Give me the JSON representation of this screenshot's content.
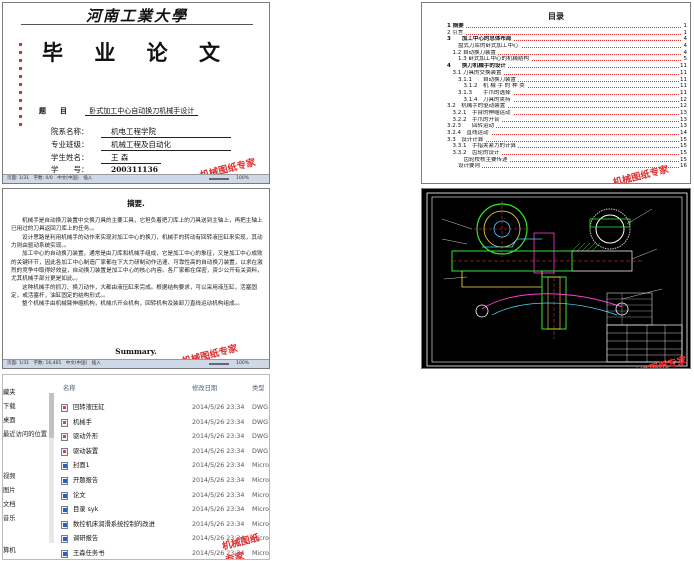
{
  "cover": {
    "school": "河南工業大學",
    "thesis": "毕 业 论 文",
    "title_label": "题　　目",
    "title_value": "卧式加工中心自动换刀机械手设计",
    "college_label": "院系名称：",
    "college_value": "机电工程学院",
    "major_label": "专业班级：",
    "major_value": "机械工程及自动化",
    "student_label": "学生姓名：",
    "student_value": "王  森",
    "id_label": "学　　号：",
    "id_value": "200311136",
    "watermark": "机械图纸专家",
    "status": "页面: 1/31　字数: 0/0　中文(中国)　插入",
    "zoom": "100%"
  },
  "toc": {
    "heading": "目录",
    "items": [
      {
        "text": "1 摘要",
        "page": "1",
        "bold": true
      },
      {
        "text": "2 引言",
        "page": "1",
        "bold": false
      },
      {
        "text": "3　　加工中心的总体布局",
        "page": "4",
        "bold": true
      },
      {
        "text": "　　盘式刀库的卧式加工中心",
        "page": "4",
        "bold": false
      },
      {
        "text": "　1.2 自动换刀装置",
        "page": "4",
        "bold": false
      },
      {
        "text": "　　1.3 卧式加工中心的机械结构",
        "page": "5",
        "bold": false
      },
      {
        "text": "4　　换刀机械手的设计",
        "page": "11",
        "bold": true
      },
      {
        "text": "　3.1 刀具的交换装置",
        "page": "11",
        "bold": false
      },
      {
        "text": "　　3.1.1　　自动换刀装置",
        "page": "11",
        "bold": false
      },
      {
        "text": "　　　3.1.2　机 械 手 的 种 类",
        "page": "11",
        "bold": false
      },
      {
        "text": "　　3.1.3　　手爪的选择",
        "page": "11",
        "bold": false
      },
      {
        "text": "　　　3.1.4　刀具的夹持",
        "page": "12",
        "bold": false
      },
      {
        "text": "3.2　机械手的驱动装置",
        "page": "12",
        "bold": false
      },
      {
        "text": "　3.2.1　手臂的伸缩运动",
        "page": "13",
        "bold": false
      },
      {
        "text": "　3.2.2　手爪的开合",
        "page": "13",
        "bold": false
      },
      {
        "text": "3.2.3　　回转运动",
        "page": "13",
        "bold": false
      },
      {
        "text": "3.2.4　直线运动",
        "page": "14",
        "bold": false
      },
      {
        "text": "3.3　设计计算",
        "page": "15",
        "bold": false
      },
      {
        "text": "　3.3.1　手指夹紧力的计算",
        "page": "15",
        "bold": false
      },
      {
        "text": "　3.3.2　齿轮的设计",
        "page": "15",
        "bold": false
      },
      {
        "text": "　　　齿轮校核主要传递",
        "page": "15",
        "bold": false
      },
      {
        "text": "　　设计要则",
        "page": "16",
        "bold": false
      }
    ]
  },
  "abstract": {
    "heading": "摘要.",
    "paragraphs": [
      "机械手是自动换刀装置中交换刀具的主要工具，它担负着把刀库上的刀具送到主轴上，再把主轴上已用过的刀具返回刀库上的任务。。",
      "设计思路是利用机械手的动作来实现对加工中心的换刀，机械手的转动有回转液压缸来实现，其动力则由驱动系统实现。。",
      "加工中心的自动换刀装置，通常是由刀库和机械手组成，它是加工中心的象征，又是加工中心成败的关键环节，因此各加工中心制造厂家都在下大力研制动作迅速、可靠性高的自动换刀装置，以求在激烈的竞争中取得好效益，自动换刀装置是加工中心的核心内容。各厂家都在保密，资少公开有关资料，尤其机械手部分更是如此。。",
      "这种机械手的抓刀、换刀动作，大都由液压缸来完成。根据结构要求，可以采用液压缸，活塞固定，或活塞杆，油缸固定的结构形式。。",
      "整个机械手由机械臂伸缩机构，机械爪开合机构，回转机构及装卸刀直线运动机构组成。。"
    ],
    "summary_heading": "Summary.",
    "watermark": "机械图纸专家",
    "status": "页面: 1/31　字数: 16,465　中文(中国)　插入",
    "zoom": "100%"
  },
  "cad": {
    "watermark": "机械图纸专家"
  },
  "explorer": {
    "nav": [
      "藏夹",
      "下载",
      "桌面",
      "最近访问的位置",
      "视频",
      "图片",
      "文档",
      "音乐",
      "算机",
      "本地磁盘"
    ],
    "columns": {
      "name": "名称",
      "date": "修改日期",
      "type": "类型"
    },
    "files": [
      {
        "name": "回转液压缸",
        "date": "2014/5/26 23:34",
        "type": "DWG 文",
        "icon": "dwg"
      },
      {
        "name": "机械手",
        "date": "2014/5/26 23:34",
        "type": "DWG 文",
        "icon": "dwg"
      },
      {
        "name": "驱动外形",
        "date": "2014/5/26 23:34",
        "type": "DWG 文",
        "icon": "dwg"
      },
      {
        "name": "驱动装置",
        "date": "2014/5/26 23:34",
        "type": "DWG 文",
        "icon": "dwg"
      },
      {
        "name": "封面1",
        "date": "2014/5/26 23:34",
        "type": "Micros",
        "icon": "doc"
      },
      {
        "name": "开题报告",
        "date": "2014/5/26 23:34",
        "type": "Micros",
        "icon": "doc"
      },
      {
        "name": "论文",
        "date": "2014/5/26 23:34",
        "type": "Micros",
        "icon": "doc"
      },
      {
        "name": "目录 syk",
        "date": "2014/5/26 23:34",
        "type": "Micros",
        "icon": "doc"
      },
      {
        "name": "数控机床润滑系统控制的改进",
        "date": "2014/5/26 23:34",
        "type": "Micros",
        "icon": "doc"
      },
      {
        "name": "调研报告",
        "date": "2014/5/26 23:34",
        "type": "Micros",
        "icon": "doc"
      },
      {
        "name": "王森任务书",
        "date": "2014/5/26 23:34",
        "type": "Micros",
        "icon": "doc"
      }
    ],
    "watermark": "机械图纸专家"
  }
}
